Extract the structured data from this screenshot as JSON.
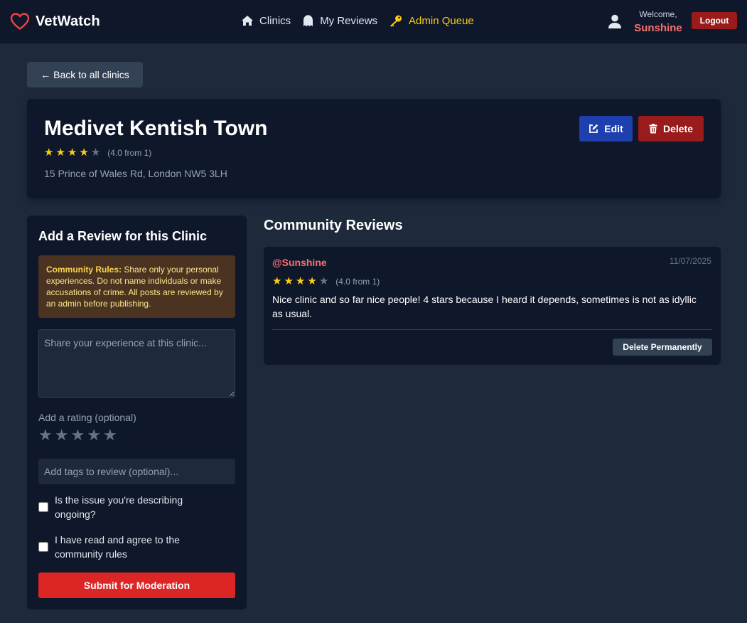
{
  "header": {
    "brand": "VetWatch",
    "nav": [
      {
        "label": "Clinics",
        "icon": "home-icon"
      },
      {
        "label": "My Reviews",
        "icon": "ghost-icon"
      },
      {
        "label": "Admin Queue",
        "icon": "key-icon"
      }
    ],
    "welcome_label": "Welcome,",
    "username": "Sunshine",
    "logout_label": "Logout"
  },
  "back_label": "← Back to all clinics",
  "clinic": {
    "name": "Medivet Kentish Town",
    "rating": 4,
    "rating_max": 5,
    "rating_text": "(4.0 from 1)",
    "address": "15 Prince of Wales Rd, London NW5 3LH",
    "edit_label": "Edit",
    "delete_label": "Delete"
  },
  "review_form": {
    "title": "Add a Review for this Clinic",
    "rules_heading": "Community Rules:",
    "rules_text": " Share only your personal experiences. Do not name individuals or make accusations of crime. All posts are reviewed by an admin before publishing.",
    "textarea_placeholder": "Share your experience at this clinic...",
    "rating_label": "Add a rating (optional)",
    "rating_value": 0,
    "tags_placeholder": "Add tags to review (optional)...",
    "ongoing_label": "Is the issue you're describing ongoing?",
    "agree_label": "I have read and agree to the community rules",
    "submit_label": "Submit for Moderation"
  },
  "reviews": {
    "title": "Community Reviews",
    "items": [
      {
        "user": "@Sunshine",
        "date": "11/07/2025",
        "rating": 4,
        "rating_text": "(4.0 from 1)",
        "body": "Nice clinic and so far nice people! 4 stars because I heard it depends, sometimes is not as idyllic as usual.",
        "delete_label": "Delete Permanently"
      }
    ]
  },
  "colors": {
    "accent_red": "#f87171",
    "admin_yellow": "#facc15",
    "star_on": "#facc15",
    "star_off": "#64748b"
  }
}
